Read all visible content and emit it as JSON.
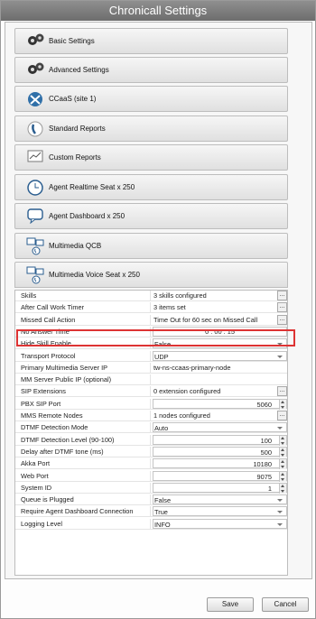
{
  "window": {
    "title": "Chronicall Settings"
  },
  "categories": [
    {
      "label": "Basic Settings",
      "icon": "gears-icon"
    },
    {
      "label": "Advanced Settings",
      "icon": "gears-icon"
    },
    {
      "label": "CCaaS (site 1)",
      "icon": "ccaas-icon"
    },
    {
      "label": "Standard Reports",
      "icon": "phone-icon"
    },
    {
      "label": "Custom Reports",
      "icon": "chart-icon"
    },
    {
      "label": "Agent Realtime Seat x 250",
      "icon": "clock-icon"
    },
    {
      "label": "Agent Dashboard x 250",
      "icon": "chat-icon"
    },
    {
      "label": "Multimedia QCB",
      "icon": "multimedia-icon"
    },
    {
      "label": "Multimedia Voice Seat x 250",
      "icon": "multimedia-icon"
    }
  ],
  "settings": [
    {
      "label": "Skills",
      "value": "3 skills configured",
      "kind": "ellipsis"
    },
    {
      "label": "After Call Work Timer",
      "value": "3 items set",
      "kind": "ellipsis"
    },
    {
      "label": "Missed Call Action",
      "value": "Time Out for 60 sec on Missed Call",
      "kind": "ellipsis"
    },
    {
      "label": "No Answer Time",
      "value": "0 : 00 : 15",
      "kind": "time"
    },
    {
      "label": "Hide Skill Enable",
      "value": "False",
      "kind": "dropdown"
    },
    {
      "label": "Transport Protocol",
      "value": "UDP",
      "kind": "dropdown"
    },
    {
      "label": "Primary Multimedia Server IP",
      "value": "tw-ns-ccaas-primary-node",
      "kind": "text"
    },
    {
      "label": "MM Server Public IP (optional)",
      "value": "",
      "kind": "text"
    },
    {
      "label": "SIP Extensions",
      "value": "0 extension configured",
      "kind": "ellipsis"
    },
    {
      "label": "PBX SIP Port",
      "value": "5060",
      "kind": "spinner"
    },
    {
      "label": "MMS Remote Nodes",
      "value": "1 nodes configured",
      "kind": "ellipsis"
    },
    {
      "label": "DTMF Detection Mode",
      "value": "Auto",
      "kind": "dropdown"
    },
    {
      "label": "DTMF Detection Level (90-100)",
      "value": "100",
      "kind": "spinner"
    },
    {
      "label": "Delay after DTMF tone (ms)",
      "value": "500",
      "kind": "spinner"
    },
    {
      "label": "Akka Port",
      "value": "10180",
      "kind": "spinner"
    },
    {
      "label": "Web Port",
      "value": "9075",
      "kind": "spinner"
    },
    {
      "label": "System ID",
      "value": "1",
      "kind": "spinner"
    },
    {
      "label": "Queue is Plugged",
      "value": "False",
      "kind": "dropdown"
    },
    {
      "label": "Require Agent Dashboard Connection",
      "value": "True",
      "kind": "dropdown"
    },
    {
      "label": "Logging Level",
      "value": "INFO",
      "kind": "dropdown"
    }
  ],
  "buttons": {
    "save": "Save",
    "cancel": "Cancel"
  },
  "ellipsis_label": "...",
  "colors": {
    "highlight": "#dd3333",
    "titlebar": "#7a7a7a"
  }
}
